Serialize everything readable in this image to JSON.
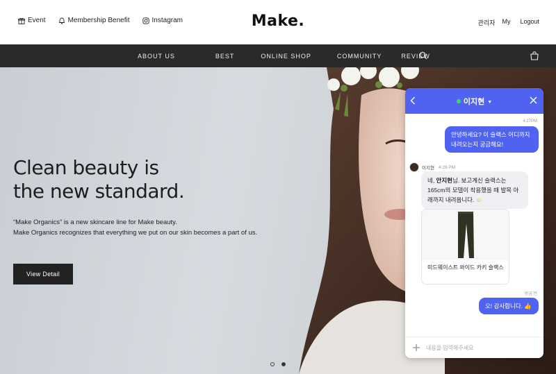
{
  "header": {
    "top_links": [
      {
        "label": "Event",
        "icon": "gift-icon"
      },
      {
        "label": "Membership Benefit",
        "icon": "bell-icon"
      },
      {
        "label": "Instagram",
        "icon": "instagram-icon"
      }
    ],
    "logo": "Make.",
    "user_links": [
      "관리자",
      "My",
      "Logout"
    ]
  },
  "nav": {
    "items": [
      "ABOUT US",
      "BEST",
      "ONLINE SHOP",
      "COMMUNITY",
      "REVIEW"
    ],
    "icons": [
      "search-icon",
      "shopping-bag-icon"
    ]
  },
  "hero": {
    "title_line1": "Clean beauty is",
    "title_line2": "the new standard.",
    "desc_line1": "“Make Organics” is a new skincare line for Make beauty.",
    "desc_line2": "Make Organics recognizes that everything we put on our skin becomes a part of us.",
    "button": "View Detail",
    "slide_count": 2,
    "active_slide": 2
  },
  "chat": {
    "title": "이지현",
    "status": "online",
    "colors": {
      "accent": "#5063f0",
      "online": "#45d36a"
    },
    "messages": {
      "out1_time": "4:27PM",
      "out1_line1": "안녕하세요? 이 슬랙스 어디까지",
      "out1_line2": "내려오는지 궁금해요!",
      "sender_name": "이지현",
      "sender_time": "4:28 PM",
      "in1_prefix": "네, ",
      "in1_bold": "안지현",
      "in1_rest": "님. 보고계신 슬랙스는",
      "in1_line2": "165cm의 모델이 착용했을 때 발목 아",
      "in1_line3": "래까지 내려옵니다. ",
      "in1_emoji": "☺",
      "product_name": "미드웨이스트 와이드 카키 슬랙스",
      "out2_time": "방금 전",
      "out2_text": "오! 감사합니다. ",
      "out2_emoji": "👍"
    },
    "input_placeholder": "내용을 입력해주세요"
  }
}
